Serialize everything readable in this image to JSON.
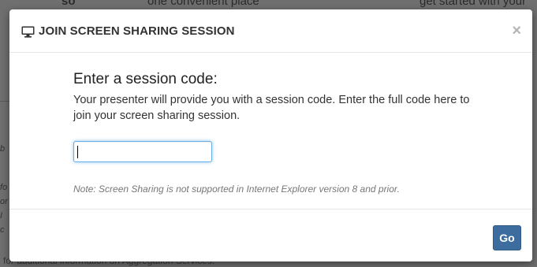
{
  "background": {
    "top_text_a": "so",
    "top_text_b": "one convenient place",
    "top_text_c": "get started with your",
    "side_fragments": [
      "b",
      "fo",
      "or",
      "I",
      "c"
    ],
    "bottom_text": "for additional information on Aggregation Services."
  },
  "modal": {
    "title": "JOIN SCREEN SHARING SESSION",
    "title_icon": "monitor-icon",
    "close_label": "×",
    "heading": "Enter a session code:",
    "description": "Your presenter will provide you with a session code. Enter the full code here to join your screen sharing session.",
    "session_code": {
      "value": "",
      "placeholder": ""
    },
    "note": "Note: Screen Sharing is not supported in Internet Explorer version 8 and prior.",
    "go_label": "Go"
  },
  "colors": {
    "primary_button": "#3d6c9e",
    "focus_ring": "#66afe9",
    "backdrop": "#6f6f6f"
  }
}
